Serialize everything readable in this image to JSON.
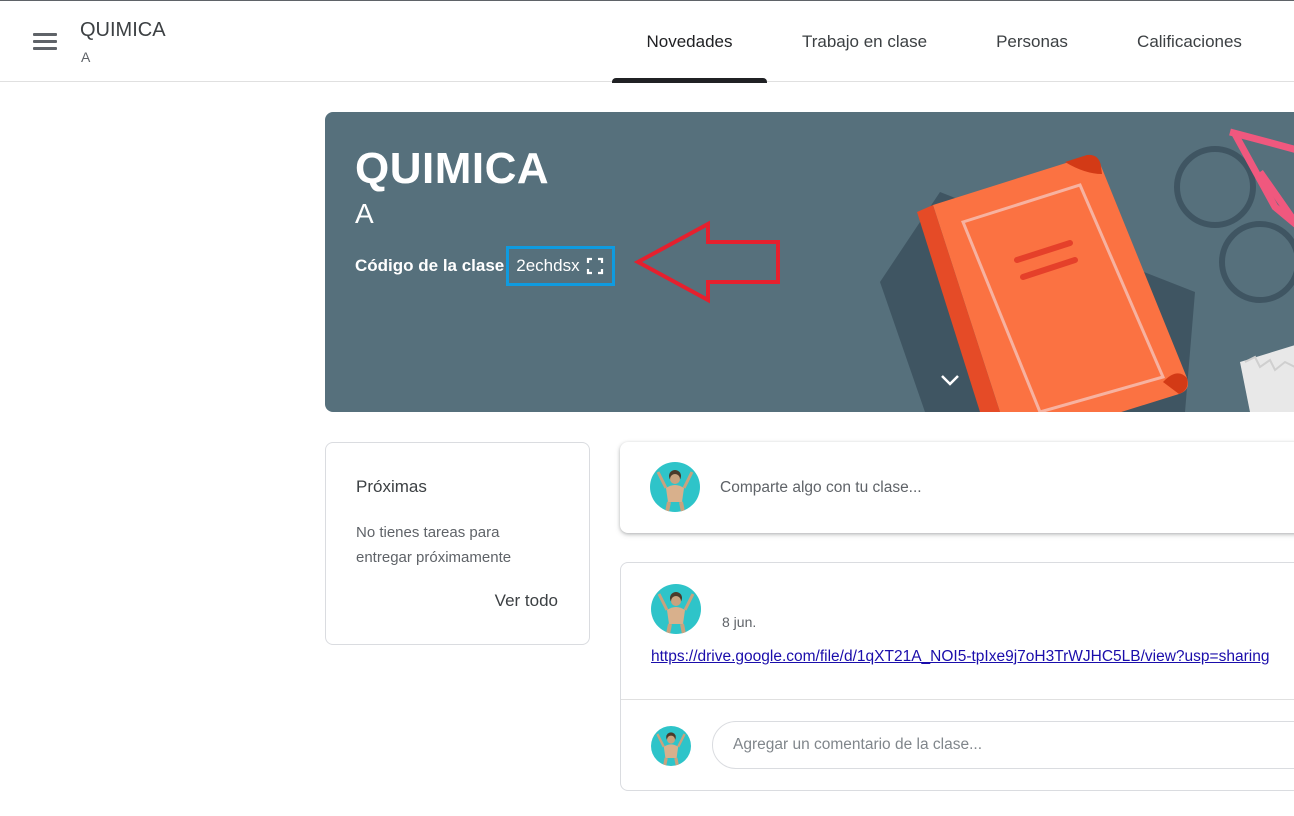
{
  "header": {
    "title": "QUIMICA",
    "subtitle": "A",
    "menu_icon": "hamburger-menu-icon"
  },
  "tabs": [
    {
      "label": "Novedades",
      "active": true
    },
    {
      "label": "Trabajo en clase",
      "active": false
    },
    {
      "label": "Personas",
      "active": false
    },
    {
      "label": "Calificaciones",
      "active": false
    }
  ],
  "banner": {
    "title": "QUIMICA",
    "section": "A",
    "code_label": "Código de la clase",
    "code_value": "2echdsx",
    "background_color": "#56707c",
    "highlight_color": "#0f9be0",
    "annotation_arrow_color": "#e5202e"
  },
  "upcoming": {
    "title": "Próximas",
    "text": "No tienes tareas para entregar próximamente",
    "view_all": "Ver todo"
  },
  "share": {
    "placeholder": "Comparte algo con tu clase..."
  },
  "post": {
    "date": "8 jun.",
    "link": "https://drive.google.com/file/d/1qXT21A_NOI5-tpIxe9j7oH3TrWJHC5LB/view?usp=sharing",
    "comment_placeholder": "Agregar un comentario de la clase..."
  }
}
